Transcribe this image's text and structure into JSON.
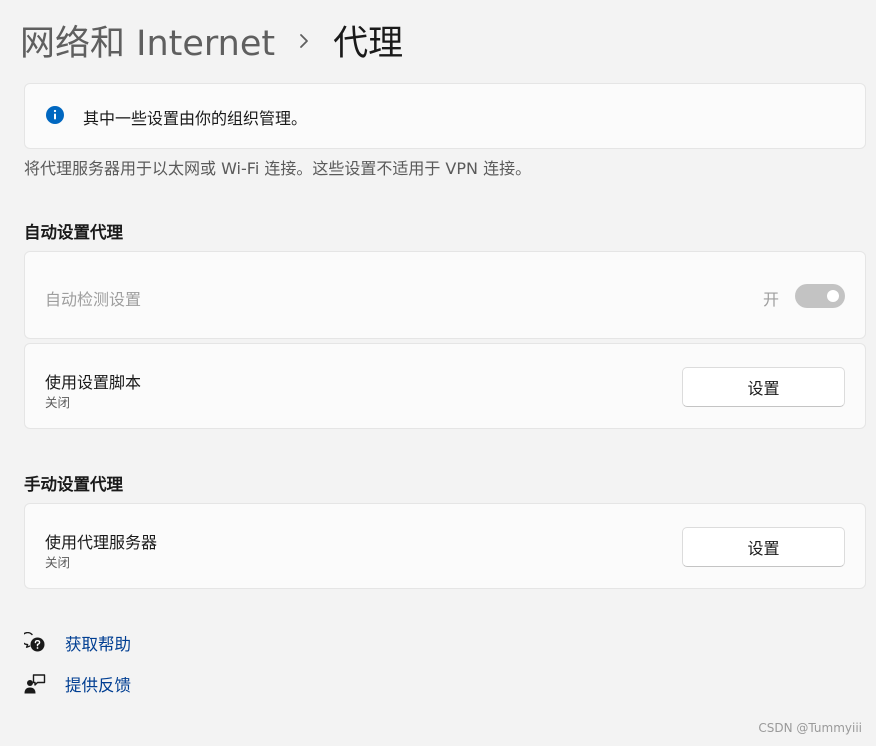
{
  "breadcrumb": {
    "parent": "网络和 Internet",
    "current": "代理"
  },
  "info_banner": {
    "icon": "info-icon",
    "text": "其中一些设置由你的组织管理。"
  },
  "description": "将代理服务器用于以太网或 Wi-Fi 连接。这些设置不适用于 VPN 连接。",
  "auto_section": {
    "title": "自动设置代理",
    "auto_detect": {
      "label": "自动检测设置",
      "toggle_label": "开",
      "toggle_on": true,
      "disabled": true
    },
    "script": {
      "label": "使用设置脚本",
      "status": "关闭",
      "button_label": "设置"
    }
  },
  "manual_section": {
    "title": "手动设置代理",
    "proxy_server": {
      "label": "使用代理服务器",
      "status": "关闭",
      "button_label": "设置"
    }
  },
  "links": {
    "help": {
      "icon": "help-chat-icon",
      "label": "获取帮助"
    },
    "feedback": {
      "icon": "feedback-icon",
      "label": "提供反馈"
    }
  },
  "watermark": "CSDN @Tummyiii",
  "colors": {
    "accent": "#0067c0",
    "link": "#003e92",
    "toggle_disabled": "#c3c3c3"
  }
}
